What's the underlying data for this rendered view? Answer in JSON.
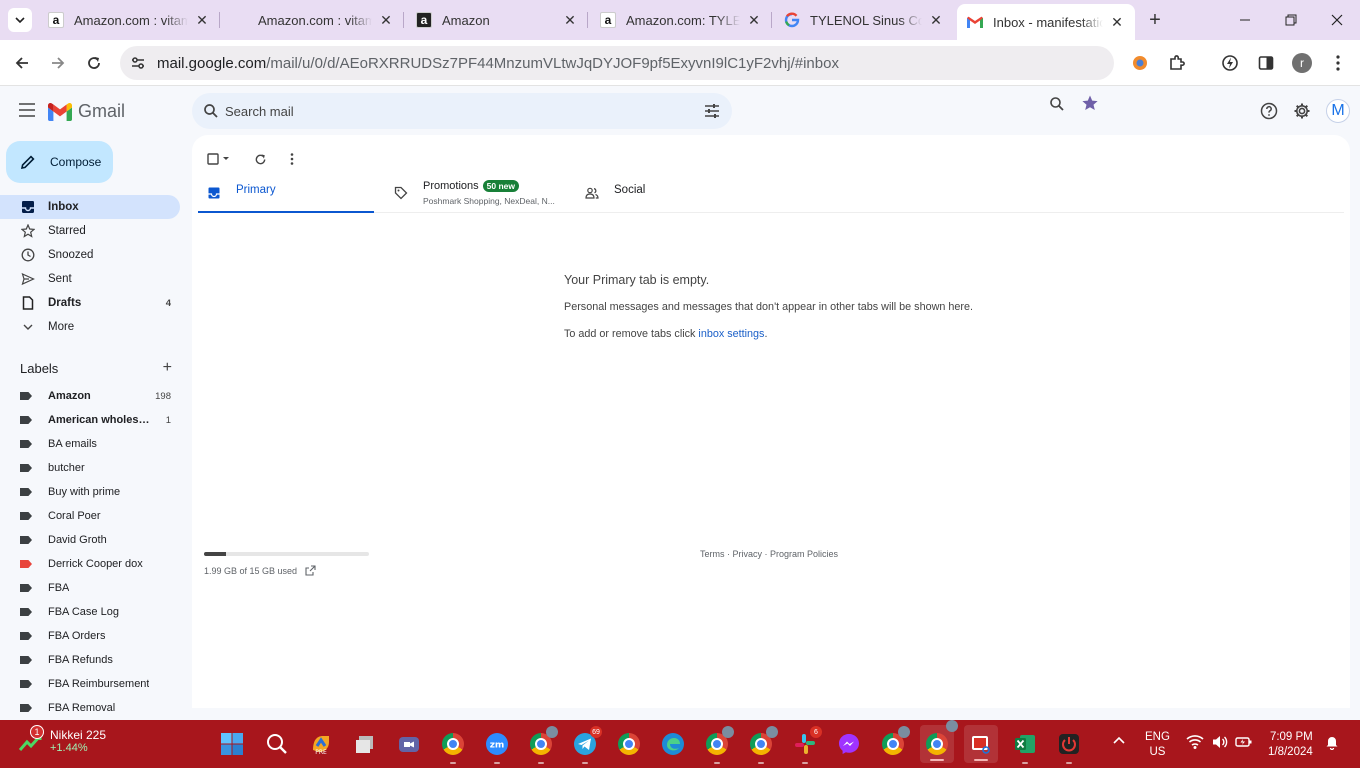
{
  "browser": {
    "tabs": [
      {
        "title": "Amazon.com : vitamin",
        "favicon": "amazon"
      },
      {
        "title": "Amazon.com : vitamin",
        "favicon": "none"
      },
      {
        "title": "Amazon",
        "favicon": "amazon-dark"
      },
      {
        "title": "Amazon.com: TYLENOL",
        "favicon": "amazon"
      },
      {
        "title": "TYLENOL Sinus Cong",
        "favicon": "google"
      },
      {
        "title": "Inbox - manifestation",
        "favicon": "gmail",
        "active": true
      }
    ],
    "url_host": "mail.google.com",
    "url_rest": "/mail/u/0/d/AEoRXRRUDSz7PF44MnzumVLtwJqDYJOF9pf5ExyvnI9lC1yF2vhj/#inbox",
    "profile_initial": "r"
  },
  "gmail": {
    "wordmark": "Gmail",
    "search_placeholder": "Search mail",
    "avatar_initial": "M",
    "compose_label": "Compose",
    "nav": [
      {
        "label": "Inbox",
        "icon": "inbox-icon",
        "count": "",
        "selected": true
      },
      {
        "label": "Starred",
        "icon": "star-icon",
        "count": ""
      },
      {
        "label": "Snoozed",
        "icon": "clock-icon",
        "count": ""
      },
      {
        "label": "Sent",
        "icon": "send-icon",
        "count": ""
      },
      {
        "label": "Drafts",
        "icon": "draft-icon",
        "count": "4",
        "bold": true
      },
      {
        "label": "More",
        "icon": "chevron-down-icon",
        "count": ""
      }
    ],
    "labels_heading": "Labels",
    "labels": [
      {
        "name": "Amazon",
        "count": "198",
        "bold": true,
        "color": "#3c4043"
      },
      {
        "name": "American wholesal...",
        "count": "1",
        "bold": true,
        "color": "#3c4043"
      },
      {
        "name": "BA emails",
        "count": "",
        "color": "#3c4043"
      },
      {
        "name": "butcher",
        "count": "",
        "color": "#3c4043"
      },
      {
        "name": "Buy with prime",
        "count": "",
        "color": "#3c4043"
      },
      {
        "name": "Coral Poer",
        "count": "",
        "color": "#3c4043"
      },
      {
        "name": "David Groth",
        "count": "",
        "color": "#3c4043"
      },
      {
        "name": "Derrick Cooper dox",
        "count": "",
        "color": "#e8453c"
      },
      {
        "name": "FBA",
        "count": "",
        "color": "#3c4043"
      },
      {
        "name": "FBA Case Log",
        "count": "",
        "color": "#3c4043"
      },
      {
        "name": "FBA Orders",
        "count": "",
        "color": "#3c4043"
      },
      {
        "name": "FBA Refunds",
        "count": "",
        "color": "#3c4043"
      },
      {
        "name": "FBA Reimbursement",
        "count": "",
        "color": "#3c4043"
      },
      {
        "name": "FBA Removal",
        "count": "",
        "color": "#3c4043"
      }
    ],
    "tabs": {
      "primary": "Primary",
      "promotions": "Promotions",
      "promotions_badge": "50 new",
      "promotions_sub": "Poshmark Shopping, NexDeal, N...",
      "social": "Social"
    },
    "empty": {
      "heading": "Your Primary tab is empty.",
      "line1": "Personal messages and messages that don't appear in other tabs will be shown here.",
      "line2_prefix": "To add or remove tabs click ",
      "line2_link": "inbox settings",
      "line2_suffix": "."
    },
    "storage": {
      "text": "1.99 GB of 15 GB used",
      "used_fraction": 0.133
    },
    "footer": {
      "terms": "Terms",
      "privacy": "Privacy",
      "policies": "Program Policies",
      "sep": " · "
    }
  },
  "taskbar": {
    "weather_title": "Nikkei 225",
    "weather_change": "+1.44%",
    "weather_badge": "1",
    "badges": {
      "telegram": "69",
      "slack": "6"
    },
    "lang_1": "ENG",
    "lang_2": "US",
    "time": "7:09 PM",
    "date": "1/8/2024"
  },
  "colors": {
    "accent": "#0b57d0",
    "compose_bg": "#c2e7ff",
    "selected_bg": "#d3e3fd",
    "tabstrip": "#e9ddf3",
    "taskbar": "#a8161c",
    "badge_green": "#188038"
  }
}
